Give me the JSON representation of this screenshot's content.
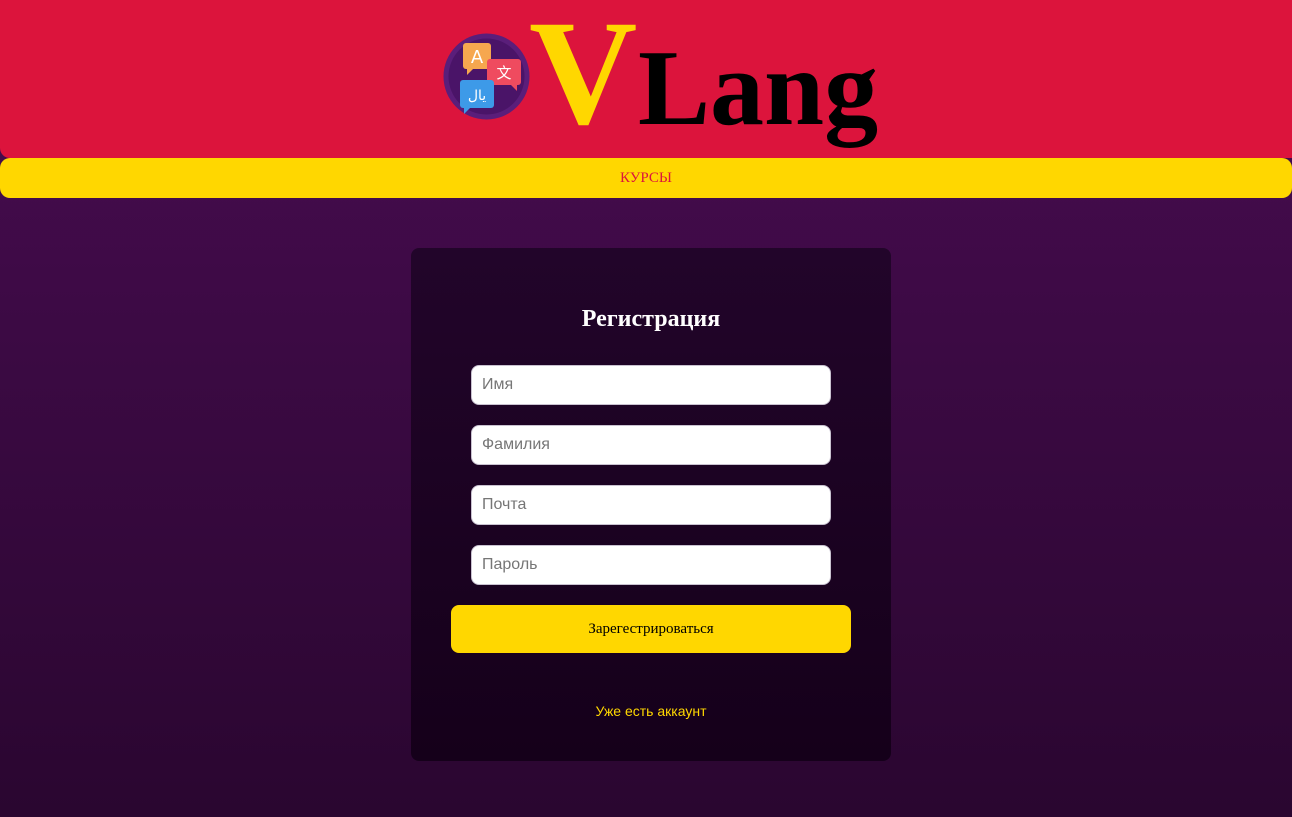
{
  "header": {
    "logo_v": "V",
    "logo_text": "Lang",
    "icon_glyphs": {
      "latin": "A",
      "chinese": "文",
      "arabic": "يال"
    }
  },
  "nav": {
    "items": [
      {
        "label": "КУРСЫ"
      }
    ]
  },
  "form": {
    "title": "Регистрация",
    "fields": [
      {
        "placeholder": "Имя",
        "value": ""
      },
      {
        "placeholder": "Фамилия",
        "value": ""
      },
      {
        "placeholder": "Почта",
        "value": ""
      },
      {
        "placeholder": "Пароль",
        "value": ""
      }
    ],
    "submit_label": "Зарегестрироваться",
    "login_link": "Уже есть аккаунт"
  },
  "colors": {
    "header_bg": "#dc143c",
    "accent_yellow": "#ffd700",
    "page_bg": "#3c0a44",
    "card_bg": "#1a0220"
  },
  "icons": [
    "translate-logo-icon"
  ]
}
